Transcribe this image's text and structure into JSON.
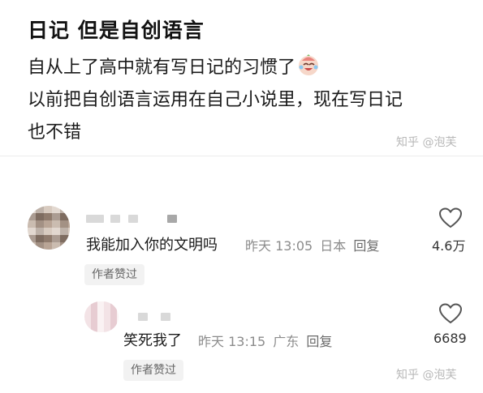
{
  "post": {
    "title": "日记 但是自创语言",
    "lines": [
      "自从上了高中就有写日记的习惯了",
      "以前把自创语言运用在自己小说里，现在写日记",
      "也不错"
    ],
    "emoji_icon": "crying-laughing-face-icon"
  },
  "watermark": "知乎 @泡芙",
  "comments": [
    {
      "text": "我能加入你的文明吗",
      "time": "昨天 13:05",
      "location": "日本",
      "reply_label": "回复",
      "likes": "4.6万",
      "author_tag": "作者赞过"
    },
    {
      "text": "笑死我了",
      "time": "昨天 13:15",
      "location": "广东",
      "reply_label": "回复",
      "likes": "6689",
      "author_tag": "作者赞过"
    }
  ]
}
